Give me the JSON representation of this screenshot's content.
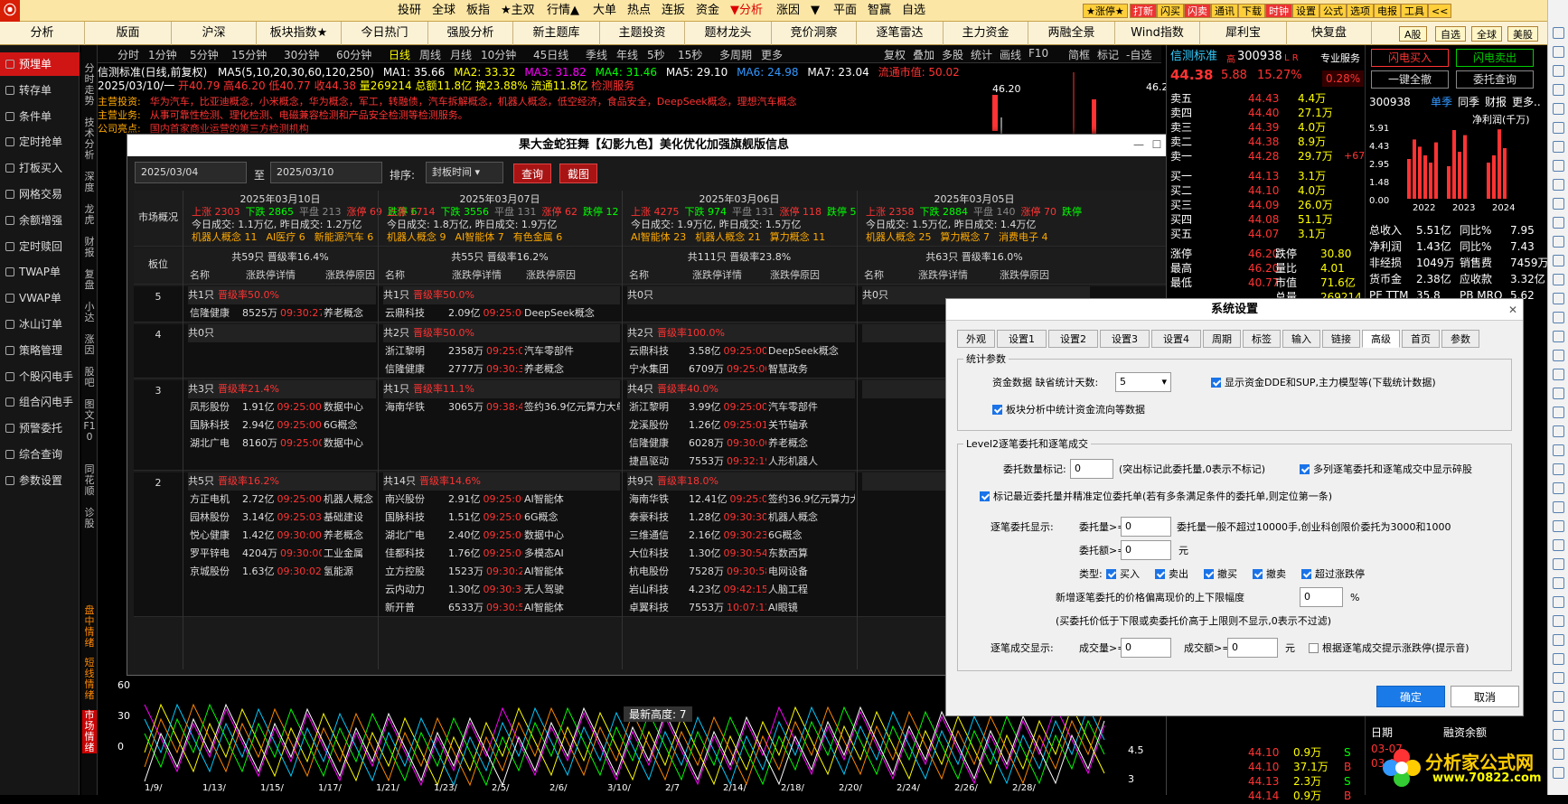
{
  "top_menu": [
    "投研",
    "全球",
    "板指",
    "★主双",
    "行情▲",
    "大单",
    "热点",
    "连扳",
    "资金",
    "▼分析",
    "涨因",
    "▼",
    "平面",
    "智赢",
    "自选"
  ],
  "top_buttons": [
    "★涨停★",
    "打新",
    "闪买",
    "闪卖",
    "通讯",
    "下载",
    "时钟",
    "设置",
    "公式",
    "选项",
    "电报",
    "工具",
    "<<"
  ],
  "nav": [
    "分析",
    "版面",
    "沪深",
    "板块指数★",
    "今日热门",
    "强股分析",
    "新主题库",
    "主题投资",
    "题材龙头",
    "竞价洞察",
    "逐笔雷达",
    "主力资金",
    "两融全景",
    "Wind指数",
    "犀利宝",
    "快复盘"
  ],
  "nav_right": [
    "A股",
    "自选",
    "全球",
    "美股"
  ],
  "sidebar": [
    "预埋单",
    "转存单",
    "条件单",
    "定时抢单",
    "打板买入",
    "网格交易",
    "余额增强",
    "定时赎回",
    "TWAP单",
    "VWAP单",
    "冰山订单",
    "策略管理",
    "个股闪电手",
    "组合闪电手",
    "预警委托",
    "综合查询",
    "参数设置"
  ],
  "vtabs": [
    "分时走势",
    "技术分析",
    "深度",
    "龙虎",
    "财报",
    "复盘",
    "小达",
    "涨因",
    "股吧",
    "图文F10",
    "同花顺",
    "诊股"
  ],
  "vtabs_bottom": [
    "盘中情绪",
    "短线情绪",
    "市场情绪"
  ],
  "period": [
    "分时",
    "1分钟",
    "5分钟",
    "15分钟",
    "30分钟",
    "60分钟",
    "日线",
    "周线",
    "月线",
    "10分钟",
    "45日线",
    "季线",
    "年线",
    "5秒",
    "15秒",
    "多周期",
    "更多"
  ],
  "period_right": [
    "复权",
    "叠加",
    "多股",
    "统计",
    "画线",
    "F10",
    "简框",
    "标记",
    "-自选",
    "返回"
  ],
  "info1": {
    "name": "信测标准(日线,前复权)",
    "ma": "MA5(5,10,20,30,60,120,250)",
    "ma1": "MA1: 35.66",
    "ma2": "MA2: 33.32",
    "ma3": "MA3: 31.82",
    "ma4": "MA4: 31.46",
    "ma5": "MA5: 29.10",
    "ma6": "MA6: 24.98",
    "ma7": "MA7: 23.04",
    "float": "流通市值: 50.02"
  },
  "info2": {
    "date": "2025/03/10/一",
    "open": "开40.79",
    "high": "高46.20",
    "low": "低40.77",
    "close": "收44.38",
    "vol": "量269214",
    "amt": "总额11.8亿",
    "turn": "换23.88%",
    "float": "流通11.8亿",
    "tag": "检测服务"
  },
  "info3": [
    {
      "k": "主营投资:",
      "v": "华为汽车，比亚迪概念，小米概念，华为概念，军工，转融债，汽车拆解概念，机器人概念，低空经济，食品安全，DeepSeek概念，理想汽车概念"
    },
    {
      "k": "主营业务:",
      "v": "从事可靠性检测、理化检测、电磁兼容检测和产品安全检测等检测服务。"
    },
    {
      "k": "公司亮点:",
      "v": "国内首家商业运营的第三方检测机构"
    }
  ],
  "price_marks": {
    "p1": "46.20",
    "p2": "46.20"
  },
  "dlg1": {
    "title": "果大金蛇狂舞【幻影九色】美化优化加强旗舰版信息",
    "date_from": "2025/03/04",
    "to": "至",
    "date_to": "2025/03/10",
    "sort_label": "排序:",
    "sort_value": "封板时间",
    "query": "查询",
    "shot": "截图",
    "overview": "市场概况",
    "board": "板位",
    "cols": [
      "名称",
      "涨跌停详情",
      "涨跌停原因"
    ]
  },
  "days": [
    {
      "date": "2025年03月10日",
      "up": "上涨 2303",
      "down": "下跌 2865",
      "flat": "平盘 213",
      "zt": "涨停 69",
      "dt": "跌停 6",
      "vol": "今日成交: 1.1万亿,  昨日成交: 1.2万亿",
      "hot": [
        "机器人概念 11",
        "AI医疗 6",
        "新能源汽车 6"
      ],
      "total": "共59只  晋级率16.4%"
    },
    {
      "date": "2025年03月07日",
      "up": "上涨 1714",
      "down": "下跌 3556",
      "flat": "平盘 131",
      "zt": "涨停 62",
      "dt": "跌停 12",
      "vol": "今日成交: 1.8万亿,  昨日成交: 1.9万亿",
      "hot": [
        "机器人概念 9",
        "AI智能体 7",
        "有色金属 6"
      ],
      "total": "共55只  晋级率16.2%"
    },
    {
      "date": "2025年03月06日",
      "up": "上涨 4275",
      "down": "下跌 974",
      "flat": "平盘 131",
      "zt": "涨停 118",
      "dt": "跌停 5",
      "vol": "今日成交: 1.9万亿,  昨日成交: 1.5万亿",
      "hot": [
        "AI智能体 23",
        "机器人概念 21",
        "算力概念 11"
      ],
      "total": "共111只  晋级率23.8%"
    },
    {
      "date": "2025年03月05日",
      "up": "上涨 2358",
      "down": "下跌 2884",
      "flat": "平盘 140",
      "zt": "涨停 70",
      "dt": "跌停",
      "vol": "今日成交: 1.5万亿,  昨日成交: 1.4万亿",
      "hot": [
        "机器人概念 25",
        "算力概念 7",
        "消费电子 4"
      ],
      "total": "共63只  晋级率16.0%"
    }
  ],
  "groups": [
    {
      "board": "5",
      "heads": [
        [
          "共1只",
          "晋级率50.0%"
        ],
        [
          "共1只",
          "晋级率50.0%"
        ],
        [
          "共0只",
          ""
        ],
        [
          "共0只",
          ""
        ]
      ],
      "rows": [
        [
          [
            "信隆健康",
            "8525万",
            "09:30:27",
            "3",
            "养老概念"
          ],
          [
            "云鼎科技",
            "2.09亿",
            "09:25:00",
            "7",
            "DeepSeek概念"
          ],
          null,
          null
        ]
      ]
    },
    {
      "board": "4",
      "heads": [
        [
          "共0只",
          ""
        ],
        [
          "共2只",
          "晋级率50.0%"
        ],
        [
          "共2只",
          "晋级率100.0%"
        ],
        [
          "",
          ""
        ]
      ],
      "rows": [
        [
          null,
          [
            "浙江黎明",
            "2358万",
            "09:25:02",
            "5",
            "汽车零部件"
          ],
          [
            "云鼎科技",
            "3.58亿",
            "09:25:00",
            "0",
            "DeepSeek概念"
          ],
          null
        ],
        [
          null,
          [
            "信隆健康",
            "2777万",
            "09:30:39",
            "2",
            "养老概念"
          ],
          [
            "宁水集团",
            "6709万",
            "09:25:00",
            "0",
            "智慧政务"
          ],
          null
        ]
      ]
    },
    {
      "board": "3",
      "heads": [
        [
          "共3只",
          "晋级率21.4%"
        ],
        [
          "共1只",
          "晋级率11.1%"
        ],
        [
          "共4只",
          "晋级率40.0%"
        ],
        [
          "",
          ""
        ]
      ],
      "rows": [
        [
          [
            "凤形股份",
            "1.91亿",
            "09:25:00",
            "0",
            "数据中心"
          ],
          [
            "海南华铁",
            "3065万",
            "09:38:48",
            "8",
            "签约36.9亿元算力大单"
          ],
          [
            "浙江黎明",
            "3.99亿",
            "09:25:00",
            "0",
            "汽车零部件"
          ],
          null
        ],
        [
          [
            "国脉科技",
            "2.94亿",
            "09:25:00",
            "0",
            "6G概念"
          ],
          null,
          [
            "龙溪股份",
            "1.26亿",
            "09:25:01",
            "0",
            "关节轴承"
          ],
          null
        ],
        [
          [
            "湖北广电",
            "8160万",
            "09:25:00",
            "3",
            "数据中心"
          ],
          null,
          [
            "信隆健康",
            "6028万",
            "09:30:00",
            "0",
            "养老概念"
          ],
          null
        ],
        [
          null,
          null,
          [
            "捷昌驱动",
            "7553万",
            "09:32:19",
            "3",
            "人形机器人"
          ],
          null
        ]
      ]
    },
    {
      "board": "2",
      "heads": [
        [
          "共5只",
          "晋级率16.2%"
        ],
        [
          "共14只",
          "晋级率14.6%"
        ],
        [
          "共9只",
          "晋级率18.0%"
        ],
        [
          "",
          ""
        ]
      ],
      "rows": [
        [
          [
            "方正电机",
            "2.72亿",
            "09:25:00",
            "0",
            "机器人概念"
          ],
          [
            "南兴股份",
            "2.91亿",
            "09:25:00",
            "0",
            "AI智能体"
          ],
          [
            "海南华铁",
            "12.41亿",
            "09:25:02",
            "0",
            "签约36.9亿元算力大单"
          ],
          null
        ],
        [
          [
            "园林股份",
            "3.14亿",
            "09:25:03",
            "0",
            "基础建设"
          ],
          [
            "国脉科技",
            "1.51亿",
            "09:25:00",
            "0",
            "6G概念"
          ],
          [
            "泰豪科技",
            "1.28亿",
            "09:30:30",
            "0",
            "机器人概念"
          ],
          null
        ],
        [
          [
            "悦心健康",
            "1.42亿",
            "09:30:00",
            "0",
            "养老概念"
          ],
          [
            "湖北广电",
            "2.40亿",
            "09:25:00",
            "0",
            "数据中心"
          ],
          [
            "三维通信",
            "2.16亿",
            "09:30:23",
            "0",
            "6G概念"
          ],
          null
        ],
        [
          [
            "罗平锌电",
            "4204万",
            "09:30:00",
            "9",
            "工业金属"
          ],
          [
            "佳都科技",
            "1.76亿",
            "09:25:00",
            "0",
            "多模态AI"
          ],
          [
            "大位科技",
            "1.30亿",
            "09:30:54",
            "1",
            "东数西算"
          ],
          null
        ],
        [
          [
            "京城股份",
            "1.63亿",
            "09:30:02",
            "0",
            "氢能源"
          ],
          [
            "立方控股",
            "1523万",
            "09:30:29",
            "7",
            "AI智能体"
          ],
          [
            "杭电股份",
            "7528万",
            "09:30:58",
            "0",
            "电网设备"
          ],
          null
        ],
        [
          null,
          [
            "云内动力",
            "1.30亿",
            "09:30:30",
            "1",
            "无人驾驶"
          ],
          [
            "岩山科技",
            "4.23亿",
            "09:42:15",
            "0",
            "人脑工程"
          ],
          null
        ],
        [
          null,
          [
            "新开普",
            "6533万",
            "09:30:51",
            "10",
            "AI智能体"
          ],
          [
            "卓翼科技",
            "7553万",
            "10:07:12",
            "11",
            "AI眼镜"
          ],
          null
        ]
      ]
    }
  ],
  "dlg2": {
    "title": "系统设置",
    "tabs": [
      "外观",
      "设置1",
      "设置2",
      "设置3",
      "设置4",
      "周期",
      "标签",
      "输入",
      "链接",
      "高级",
      "首页",
      "参数"
    ],
    "sel_tab": "高级",
    "g1": "统计参数",
    "fund_label": "资金数据 缺省统计天数:",
    "fund_days": "5",
    "chk_dde": "显示资金DDE和SUP,主力模型等(下载统计数据)",
    "chk_flow": "板块分析中统计资金流向等数据",
    "g2": "Level2逐笔委托和逐笔成交",
    "mark_label": "委托数量标记:",
    "mark_val": "0",
    "mark_hint": "(突出标记此委托量,0表示不标记)",
    "chk_multi": "多列逐笔委托和逐笔成交中显示碎股",
    "chk_recent": "标记最近委托量并精准定位委托单(若有多条满足条件的委托单,则定位第一条)",
    "disp_label": "逐笔委托显示:",
    "vol_ge": "委托量>=",
    "vol_val": "0",
    "vol_hint": "委托量一般不超过10000手,创业科创限价委托为3000和1000",
    "amt_ge": "委托额>=",
    "amt_val": "0",
    "amt_unit": "元",
    "type_label": "类型:",
    "types": [
      "买入",
      "卖出",
      "撤买",
      "撤卖",
      "超过涨跌停"
    ],
    "dev_label": "新增逐笔委托的价格偏离现价的上下限幅度",
    "dev_val": "0",
    "dev_unit": "%",
    "dev_hint": "(买委托价低于下限或卖委托价高于上限则不显示,0表示不过滤)",
    "trade_label": "逐笔成交显示:",
    "tvol_ge": "成交量>=",
    "tvol_val": "0",
    "tamt_ge": "成交额>=",
    "tamt_val": "0",
    "tamt_unit": "元",
    "chk_tick": "根据逐笔成交提示涨跌停(提示音)",
    "ok": "确定",
    "cancel": "取消"
  },
  "quote": {
    "name": "信测标准",
    "tag": "高",
    "code": "300938",
    "lr": "L R",
    "pro": "专业服务",
    "price": "44.38",
    "chg": "5.88",
    "pct": "15.27%",
    "pct2": "0.28%"
  },
  "orderbook": {
    "sells": [
      [
        "卖五",
        "44.43",
        "4.4万"
      ],
      [
        "卖四",
        "44.40",
        "27.1万"
      ],
      [
        "卖三",
        "44.39",
        "4.0万"
      ],
      [
        "卖二",
        "44.38",
        "8.9万"
      ],
      [
        "卖一",
        "44.28",
        "29.7万"
      ]
    ],
    "buys": [
      [
        "买一",
        "44.13",
        "3.1万"
      ],
      [
        "买二",
        "44.10",
        "4.0万"
      ],
      [
        "买三",
        "44.09",
        "26.0万"
      ],
      [
        "买四",
        "44.08",
        "51.1万"
      ],
      [
        "买五",
        "44.07",
        "3.1万"
      ]
    ],
    "extra_sell": "+67"
  },
  "stats": [
    [
      "涨停",
      "46.20",
      "跌停",
      "30.80"
    ],
    [
      "最高",
      "46.20",
      "量比",
      "4.01"
    ],
    [
      "最低",
      "40.77",
      "市值",
      "71.6亿"
    ],
    [
      "",
      "",
      "总量",
      "269214"
    ]
  ],
  "right_btns": [
    "闪电买入",
    "闪电卖出",
    "一键全撤",
    "委托查询"
  ],
  "rp2": {
    "code": "300938",
    "tabs": [
      "单季",
      "同季",
      "财报",
      "更多.."
    ],
    "chart_title": "净利润(千万)",
    "yticks": [
      "5.91",
      "4.43",
      "2.95",
      "1.48",
      "0.00"
    ],
    "years": [
      "2022",
      "2023",
      "2024"
    ],
    "fin": [
      [
        "总收入",
        "5.51亿",
        "同比%",
        "7.95"
      ],
      [
        "净利润",
        "1.43亿",
        "同比%",
        "7.43"
      ],
      [
        "非经损",
        "1049万",
        "销售费",
        "7459万"
      ],
      [
        "货币金",
        "2.38亿",
        "应收款",
        "3.32亿"
      ],
      [
        "PE TTM",
        "35.8",
        "PB MRQ",
        "5.62"
      ]
    ],
    "dates_hdr": [
      "日期",
      "融资余额"
    ],
    "dates": [
      "03-07",
      "03-06"
    ]
  },
  "bottom_trades": [
    [
      "44.10",
      "0.9万",
      "S"
    ],
    [
      "44.10",
      "37.1万",
      "B"
    ],
    [
      "44.13",
      "2.3万",
      "S"
    ],
    [
      "44.14",
      "0.9万",
      "B"
    ]
  ],
  "bottom_chart": {
    "legend": "最新高度: 7",
    "yticks": [
      "60",
      "30",
      "0"
    ],
    "rticks": [
      "4.5",
      "3"
    ],
    "xticks": [
      "1/9/",
      "1/13/",
      "1/15/",
      "1/17/",
      "1/21/",
      "1/23/",
      "2/5/",
      "2/6/",
      "3/10/",
      "2/7",
      "2/14/",
      "2/18/",
      "2/20/",
      "2/24/",
      "2/26/",
      "2/28/"
    ]
  },
  "watermark": {
    "cn": "分析家公式网",
    "url": "www.70822.com"
  },
  "chart_data": {
    "type": "bar",
    "title": "净利润(千万)",
    "categories": [
      "2022",
      "2023",
      "2024"
    ],
    "yticks": [
      5.91,
      4.43,
      2.95,
      1.48,
      0.0
    ],
    "ylim": [
      0,
      5.91
    ]
  }
}
